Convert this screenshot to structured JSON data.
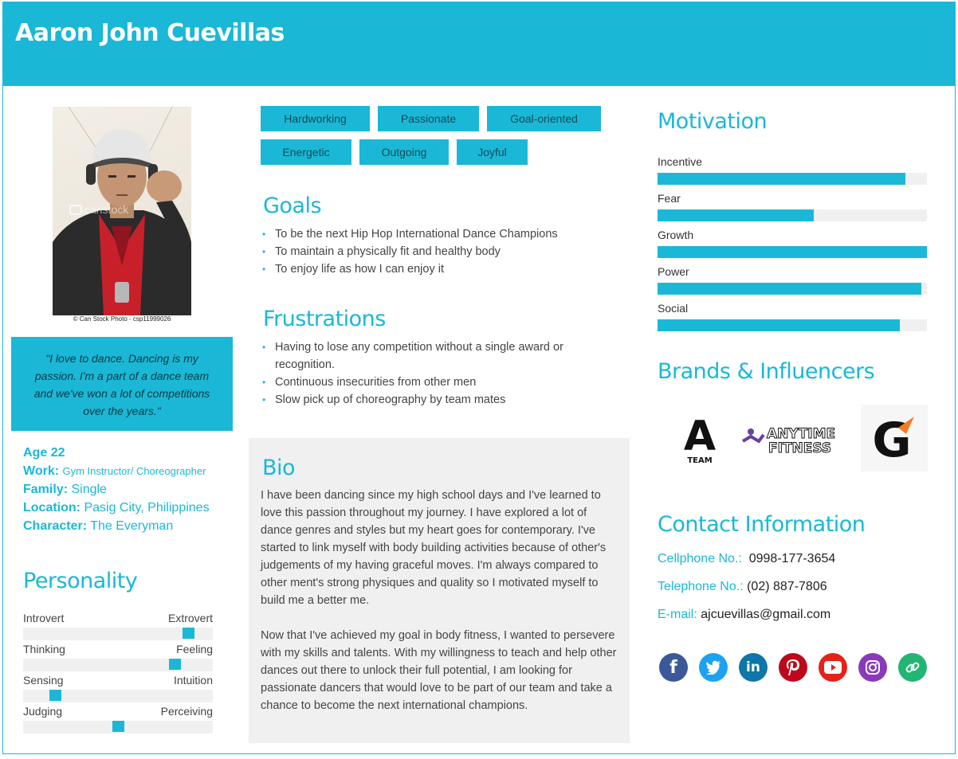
{
  "header": {
    "name": "Aaron John Cuevillas"
  },
  "photo": {
    "caption": "© Can Stock Photo - csp11999026",
    "watermark": "canstock"
  },
  "quote": "\"I love to dance. Dancing is my passion. I'm a part of a dance team and we've won a lot of competitions over the years.\"",
  "facts": {
    "age_label": "Age",
    "age": "22",
    "work_label": "Work:",
    "work": "Gym Instructor/ Choreographer",
    "family_label": "Family:",
    "family": "Single",
    "location_label": "Location:",
    "location": "Pasig City, Philippines",
    "character_label": "Character:",
    "character": "The Everyman"
  },
  "personality": {
    "title": "Personality",
    "traits": [
      {
        "left": "Introvert",
        "right": "Extrovert",
        "value": 0.87
      },
      {
        "left": "Thinking",
        "right": "Feeling",
        "value": 0.8
      },
      {
        "left": "Sensing",
        "right": "Intuition",
        "value": 0.17
      },
      {
        "left": "Judging",
        "right": "Perceiving",
        "value": 0.5
      }
    ]
  },
  "tags": [
    "Hardworking",
    "Passionate",
    "Goal-oriented",
    "Energetic",
    "Outgoing",
    "Joyful"
  ],
  "goals": {
    "title": "Goals",
    "items": [
      "To be the next Hip Hop International Dance Champions",
      "To maintain a physically fit and healthy body",
      "To enjoy life as how I can enjoy it"
    ]
  },
  "frustrations": {
    "title": "Frustrations",
    "items": [
      "Having to lose any competition without a single award or recognition.",
      "Continuous insecurities from other men",
      "Slow pick up of choreography by team mates"
    ]
  },
  "bio": {
    "title": "Bio",
    "p1": "I have been dancing since my high school days and I've learned to love this passion throughout my journey. I have explored a lot of dance genres and styles but my heart goes for contemporary. I've started to link myself with body building activities because of other's judgements of my having graceful moves. I'm always compared to other ment's strong physiques and quality so I motivated myself to build me a better me.",
    "p2": "Now that I've achieved my goal in body fitness, I wanted to persevere with my skills and talents. With my willingness to teach and help other dances out there to unlock their full potential, I am looking for passionate dancers that would love to be part of our team and take a chance to become the next international champions."
  },
  "motivation": {
    "title": "Motivation",
    "items": [
      {
        "label": "Incentive",
        "value": 0.92
      },
      {
        "label": "Fear",
        "value": 0.58
      },
      {
        "label": "Growth",
        "value": 1.0
      },
      {
        "label": "Power",
        "value": 0.98
      },
      {
        "label": "Social",
        "value": 0.9
      }
    ]
  },
  "brands": {
    "title": "Brands & Influencers",
    "a_team_letter": "A",
    "a_team_word": "TEAM",
    "anytime_line1": "ANYTIME",
    "anytime_line2": "FITNESS",
    "gatorade_letter": "G"
  },
  "contact": {
    "title": "Contact Information",
    "cell_label": "Cellphone No.:",
    "cell": "0998-177-3654",
    "tel_label": "Telephone No.:",
    "tel": "(02) 887-7806",
    "email_label": "E-mail:",
    "email": "ajcuevillas@gmail.com"
  },
  "social": [
    {
      "name": "facebook",
      "color": "#3b5998",
      "glyph": "f"
    },
    {
      "name": "twitter",
      "color": "#1da1f2",
      "glyph": ""
    },
    {
      "name": "linkedin",
      "color": "#0e76a8",
      "glyph": "in"
    },
    {
      "name": "pinterest",
      "color": "#bd081c",
      "glyph": ""
    },
    {
      "name": "youtube",
      "color": "#e62117",
      "glyph": ""
    },
    {
      "name": "instagram",
      "color": "#8a3ab9",
      "glyph": ""
    },
    {
      "name": "link",
      "color": "#22b573",
      "glyph": ""
    }
  ],
  "colors": {
    "accent": "#1ab8d6",
    "panel": "#f0f0f0"
  }
}
